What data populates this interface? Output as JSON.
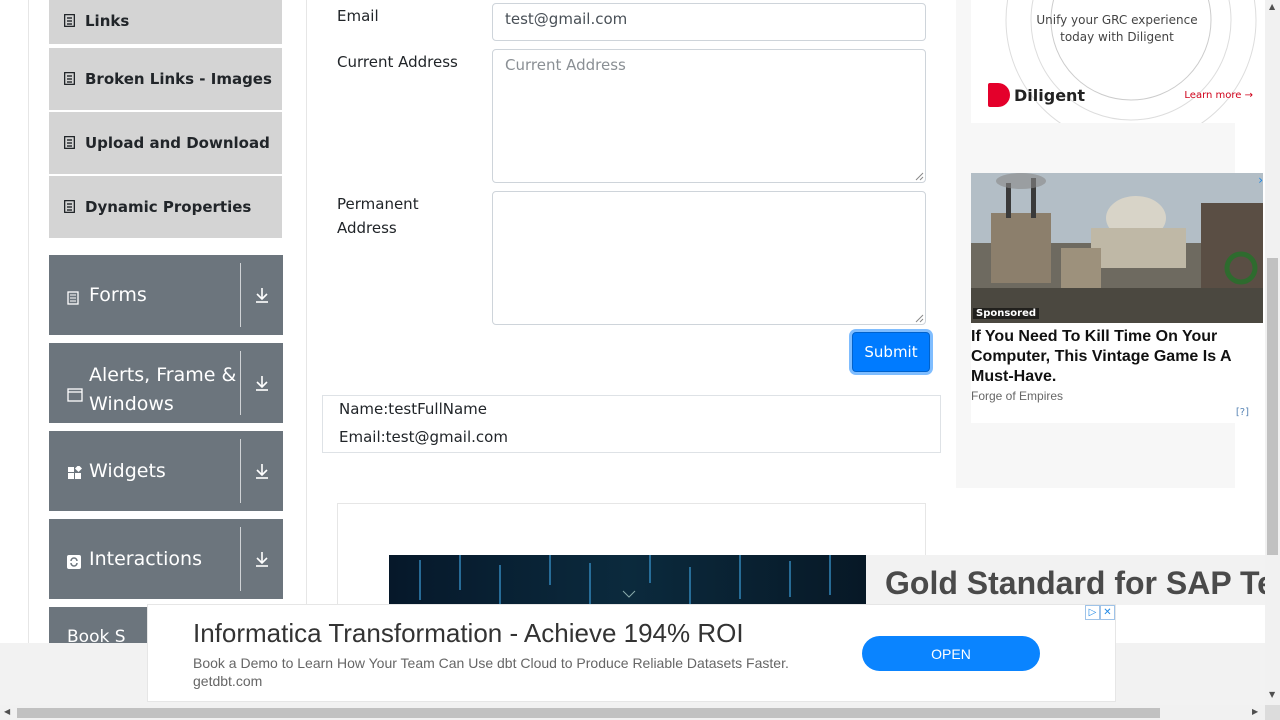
{
  "sidebar": {
    "sub_items": [
      {
        "label": "Links",
        "icon": "list-icon"
      },
      {
        "label": "Broken Links - Images",
        "icon": "list-icon"
      },
      {
        "label": "Upload and Download",
        "icon": "list-icon"
      },
      {
        "label": "Dynamic Properties",
        "icon": "list-icon"
      }
    ],
    "groups": [
      {
        "label": "Forms",
        "icon": "document-icon"
      },
      {
        "label_line1": "Alerts, Frame &",
        "label_line2": "Windows",
        "icon": "window-icon"
      },
      {
        "label": "Widgets",
        "icon": "widgets-icon"
      },
      {
        "label": "Interactions",
        "icon": "interactions-icon"
      }
    ],
    "partial_group_label": "Book S"
  },
  "form": {
    "email_label": "Email",
    "email_value": "test@gmail.com",
    "current_address_label": "Current Address",
    "current_address_placeholder": "Current Address",
    "permanent_address_label_line1": "Permanent",
    "permanent_address_label_line2": "Address",
    "submit_label": "Submit"
  },
  "output": {
    "name": "Name:testFullName",
    "email": "Email:test@gmail.com"
  },
  "ads": {
    "grc_line1": "Unify your GRC experience",
    "grc_line2": "today with Diligent",
    "diligent_brand": "Diligent",
    "learn_more": "Learn more →",
    "sponsored": "Sponsored",
    "game_title": "If You Need To Kill Time On Your Computer, This Vintage Game Is A Must-Have.",
    "game_source": "Forge of Empires",
    "game_info": "[?]",
    "banner_text": "Gold Standard for SAP Tes",
    "bottom_title": "Informatica Transformation - Achieve 194% ROI",
    "bottom_desc": "Book a Demo to Learn How Your Team Can Use dbt Cloud to Produce Reliable Datasets Faster.",
    "bottom_url": "getdbt.com",
    "bottom_cta": "OPEN"
  },
  "colors": {
    "primary": "#007bff",
    "sidebar_group": "#6c757d",
    "sidebar_item": "#d4d4d4",
    "diligent_red": "#e4002b"
  }
}
